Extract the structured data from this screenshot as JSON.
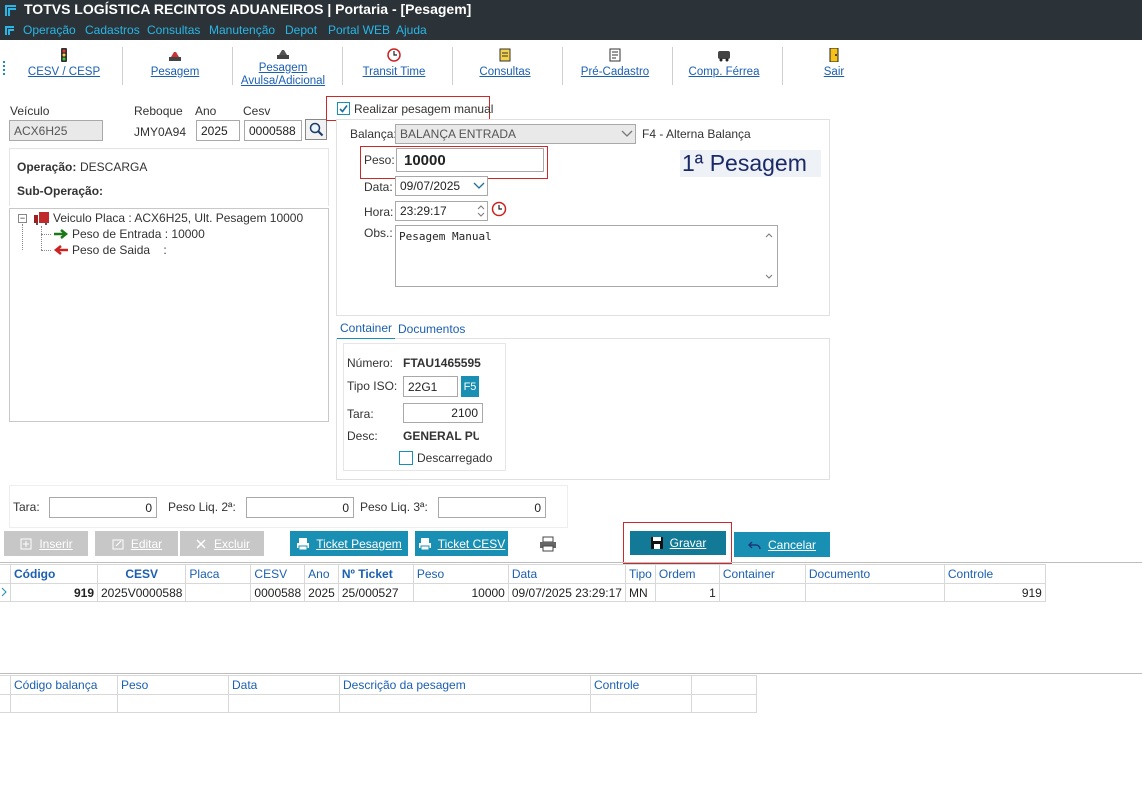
{
  "app": {
    "title": "TOTVS LOGÍSTICA RECINTOS ADUANEIROS | Portaria - [Pesagem]",
    "menu": [
      "Operação",
      "Cadastros",
      "Consultas",
      "Manutenção",
      "Depot",
      "Portal WEB",
      "Ajuda"
    ]
  },
  "toolbar": [
    {
      "label": "CESV / CESP",
      "icon": "traffic-light-icon"
    },
    {
      "label": "Pesagem",
      "icon": "scale-icon"
    },
    {
      "label": "Pesagem",
      "label2": "Avulsa/Adicional",
      "icon": "scale-extra-icon"
    },
    {
      "label": "Transit Time",
      "icon": "clock-icon"
    },
    {
      "label": "Consultas",
      "icon": "search-doc-icon"
    },
    {
      "label": "Pré-Cadastro",
      "icon": "register-icon"
    },
    {
      "label": "Comp. Férrea",
      "icon": "train-icon"
    },
    {
      "label": "Sair",
      "icon": "exit-door-icon"
    }
  ],
  "header": {
    "veiculo_label": "Veículo",
    "veiculo": "ACX6H25",
    "reboque_label": "Reboque",
    "reboque": "JMY0A94",
    "ano_label": "Ano",
    "ano": "2025",
    "cesv_label": "Cesv",
    "cesv": "0000588"
  },
  "manual": {
    "label": "Realizar pesagem manual",
    "checked": true
  },
  "operacao": {
    "op_label": "Operação:",
    "op_value": "DESCARGA",
    "subop_label": "Sub-Operação:"
  },
  "tree": {
    "root": "Veiculo Placa : ACX6H25, Ult. Pesagem 10000",
    "entrada": "Peso de Entrada : 10000",
    "saida": "Peso de Saida    :"
  },
  "form": {
    "balanca_label": "Balança:",
    "balanca": "BALANÇA ENTRADA",
    "alterna": "F4 - Alterna Balança",
    "peso_label": "Peso:",
    "peso": "10000",
    "pesagem_num": "1ª Pesagem",
    "data_label": "Data:",
    "data": "09/07/2025",
    "hora_label": "Hora:",
    "hora": "23:29:17",
    "obs_label": "Obs.:",
    "obs": "Pesagem Manual"
  },
  "tabs": [
    "Container",
    "Documentos"
  ],
  "container": {
    "numero_label": "Número:",
    "numero": "FTAU1465595",
    "iso_label": "Tipo ISO:",
    "iso": "22G1",
    "f5": "F5",
    "tara_label": "Tara:",
    "tara": "2100",
    "desc_label": "Desc:",
    "desc": "GENERAL PUR",
    "descarregado_label": "Descarregado"
  },
  "totals": {
    "tara_label": "Tara:",
    "tara": "0",
    "liq2_label": "Peso Liq. 2ª:",
    "liq2": "0",
    "liq3_label": "Peso Liq. 3ª:",
    "liq3": "0"
  },
  "actions": {
    "inserir": "Inserir",
    "editar": "Editar",
    "excluir": "Excluir",
    "ticket_pesagem": "Ticket Pesagem",
    "ticket_cesv": "Ticket CESV",
    "gravar": "Gravar",
    "cancelar": "Cancelar"
  },
  "grid1": {
    "headers": [
      "Código",
      "CESV",
      "Placa",
      "CESV",
      "Ano",
      "Nº Ticket",
      "Peso",
      "Data",
      "Tipo",
      "Ordem",
      "Container",
      "Documento",
      "Controle"
    ],
    "rows": [
      [
        "919",
        "2025V0000588",
        "",
        "0000588",
        "2025",
        "25/000527",
        "10000",
        "09/07/2025 23:29:17",
        "MN",
        "1",
        "",
        "",
        "919"
      ]
    ]
  },
  "grid2": {
    "headers": [
      "Código balança",
      "Peso",
      "Data",
      "Descrição da pesagem",
      "Controle",
      ""
    ]
  },
  "colors": {
    "accent": "#1a8fb4",
    "titlebar": "#2c3338",
    "menu": "#29b6e6",
    "link": "#1b5fb0",
    "highlight_box": "#cc2a2a"
  }
}
